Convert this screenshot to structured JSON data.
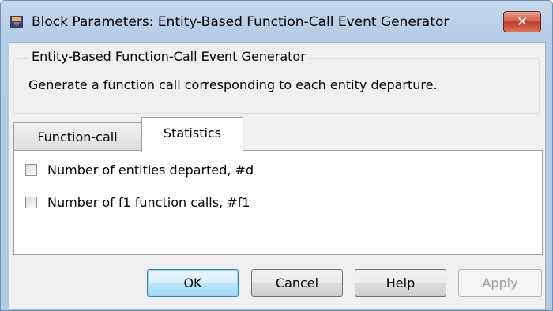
{
  "window": {
    "title": "Block Parameters: Entity-Based Function-Call Event Generator",
    "close_glyph": "✕",
    "icon": "simulink-block-icon"
  },
  "group": {
    "legend": "Entity-Based Function-Call Event Generator",
    "description": "Generate a function call corresponding to each entity departure."
  },
  "tabs": [
    {
      "label": "Function-call",
      "selected": false
    },
    {
      "label": "Statistics",
      "selected": true
    }
  ],
  "statistics": {
    "options": [
      {
        "label": "Number of entities departed, #d",
        "checked": false
      },
      {
        "label": "Number of f1 function calls, #f1",
        "checked": false
      }
    ]
  },
  "buttons": {
    "ok": "OK",
    "cancel": "Cancel",
    "help": "Help",
    "apply": "Apply"
  }
}
